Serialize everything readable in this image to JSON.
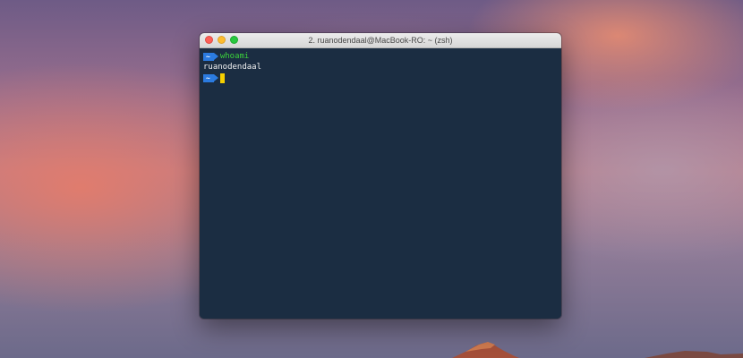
{
  "window": {
    "title": "2. ruanodendaal@MacBook-RO: ~ (zsh)"
  },
  "terminal": {
    "prompt_symbol": "~",
    "lines": [
      {
        "type": "command",
        "prompt": "~",
        "text": "whoami"
      },
      {
        "type": "output",
        "text": "ruanodendaal"
      },
      {
        "type": "command",
        "prompt": "~",
        "text": ""
      }
    ]
  },
  "colors": {
    "terminal_bg": "#1b2d42",
    "prompt_bg": "#2b7be0",
    "command_text": "#3bd33b",
    "cursor": "#f5cf00"
  },
  "icons": [
    "close-button",
    "minimize-button",
    "zoom-button"
  ]
}
